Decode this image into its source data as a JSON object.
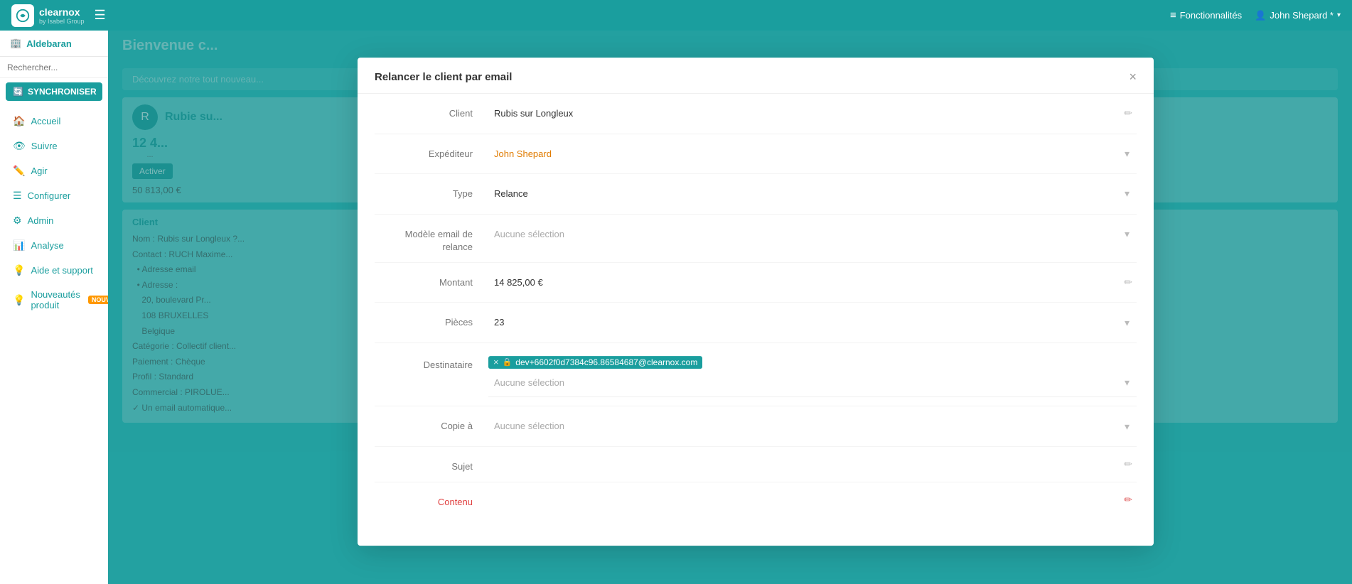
{
  "app": {
    "logo_text": "clearnox",
    "logo_sub": "by Isabel Group",
    "hamburger_icon": "☰"
  },
  "topnav": {
    "fonctionnalites_label": "Fonctionnalités",
    "user_label": "John Shepard *"
  },
  "sidebar": {
    "company": "Aldebaran",
    "search_placeholder": "Rechercher...",
    "sync_label": "SYNCHRONISER",
    "nav_items": [
      {
        "label": "Accueil",
        "icon": "🏠"
      },
      {
        "label": "Suivre",
        "icon": "👁"
      },
      {
        "label": "Agir",
        "icon": "✏️"
      },
      {
        "label": "Configurer",
        "icon": "☰"
      },
      {
        "label": "Admin",
        "icon": "⚙"
      },
      {
        "label": "Analyse",
        "icon": "📊"
      },
      {
        "label": "Aide et support",
        "icon": "💡"
      },
      {
        "label": "Nouveautés produit",
        "icon": "💡",
        "badge": "NOUV"
      }
    ]
  },
  "modal": {
    "title": "Relancer le client par email",
    "close_icon": "×",
    "fields": {
      "client_label": "Client",
      "client_value": "Rubis sur Longleux",
      "expediteur_label": "Expéditeur",
      "expediteur_value": "John Shepard",
      "type_label": "Type",
      "type_value": "Relance",
      "modele_label": "Modèle email de relance",
      "modele_placeholder": "Aucune sélection",
      "montant_label": "Montant",
      "montant_value": "14 825,00 €",
      "pieces_label": "Pièces",
      "pieces_value": "23",
      "destinataire_label": "Destinataire",
      "destinataire_email_tag": "dev+6602f0d7384c96.86584687@clearnox.com",
      "destinataire_placeholder": "Aucune sélection",
      "copie_label": "Copie à",
      "copie_placeholder": "Aucune sélection",
      "sujet_label": "Sujet",
      "contenu_label": "Contenu"
    }
  }
}
